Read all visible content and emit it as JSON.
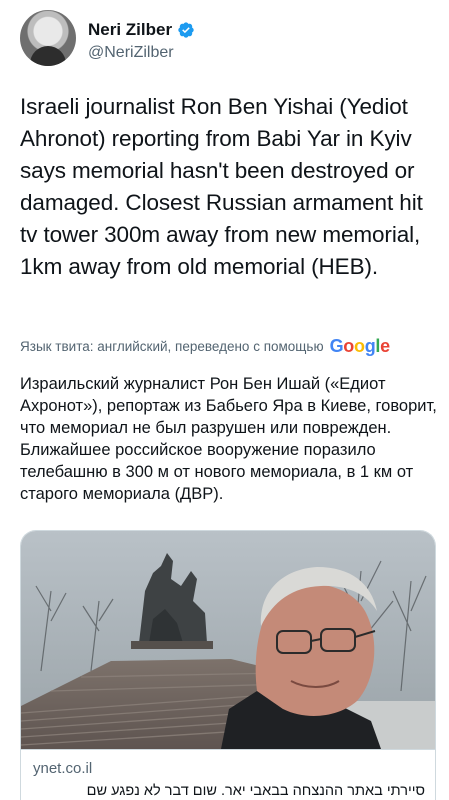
{
  "author": {
    "display_name": "Neri Zilber",
    "handle": "@NeriZilber",
    "verified_color": "#1d9bf0"
  },
  "tweet": {
    "text": "Israeli journalist Ron Ben Yishai (Yediot Ahronot) reporting from Babi Yar in Kyiv says memorial hasn't been destroyed or damaged. Closest Russian armament hit tv tower 300m away from new memorial, 1km away from old memorial (HEB)."
  },
  "translation": {
    "label": "Язык твита: английский, переведено с помощью",
    "provider": "Google",
    "text": "Израильский журналист Рон Бен Ишай («Едиот Ахронот»), репортаж из Бабьего Яра в Киеве, говорит, что мемориал не был разрушен или поврежден. Ближайшее российское вооружение поразило телебашню в 300 м от нового мемориала, в 1 км от старого мемориала (ДВР)."
  },
  "link_card": {
    "domain": "ynet.co.il",
    "title": "סיירתי באתר ההנצחה בבאבי יאר. שום דבר לא נפגע שם"
  },
  "icons": {
    "verified": "verified-badge-icon",
    "avatar": "avatar"
  }
}
